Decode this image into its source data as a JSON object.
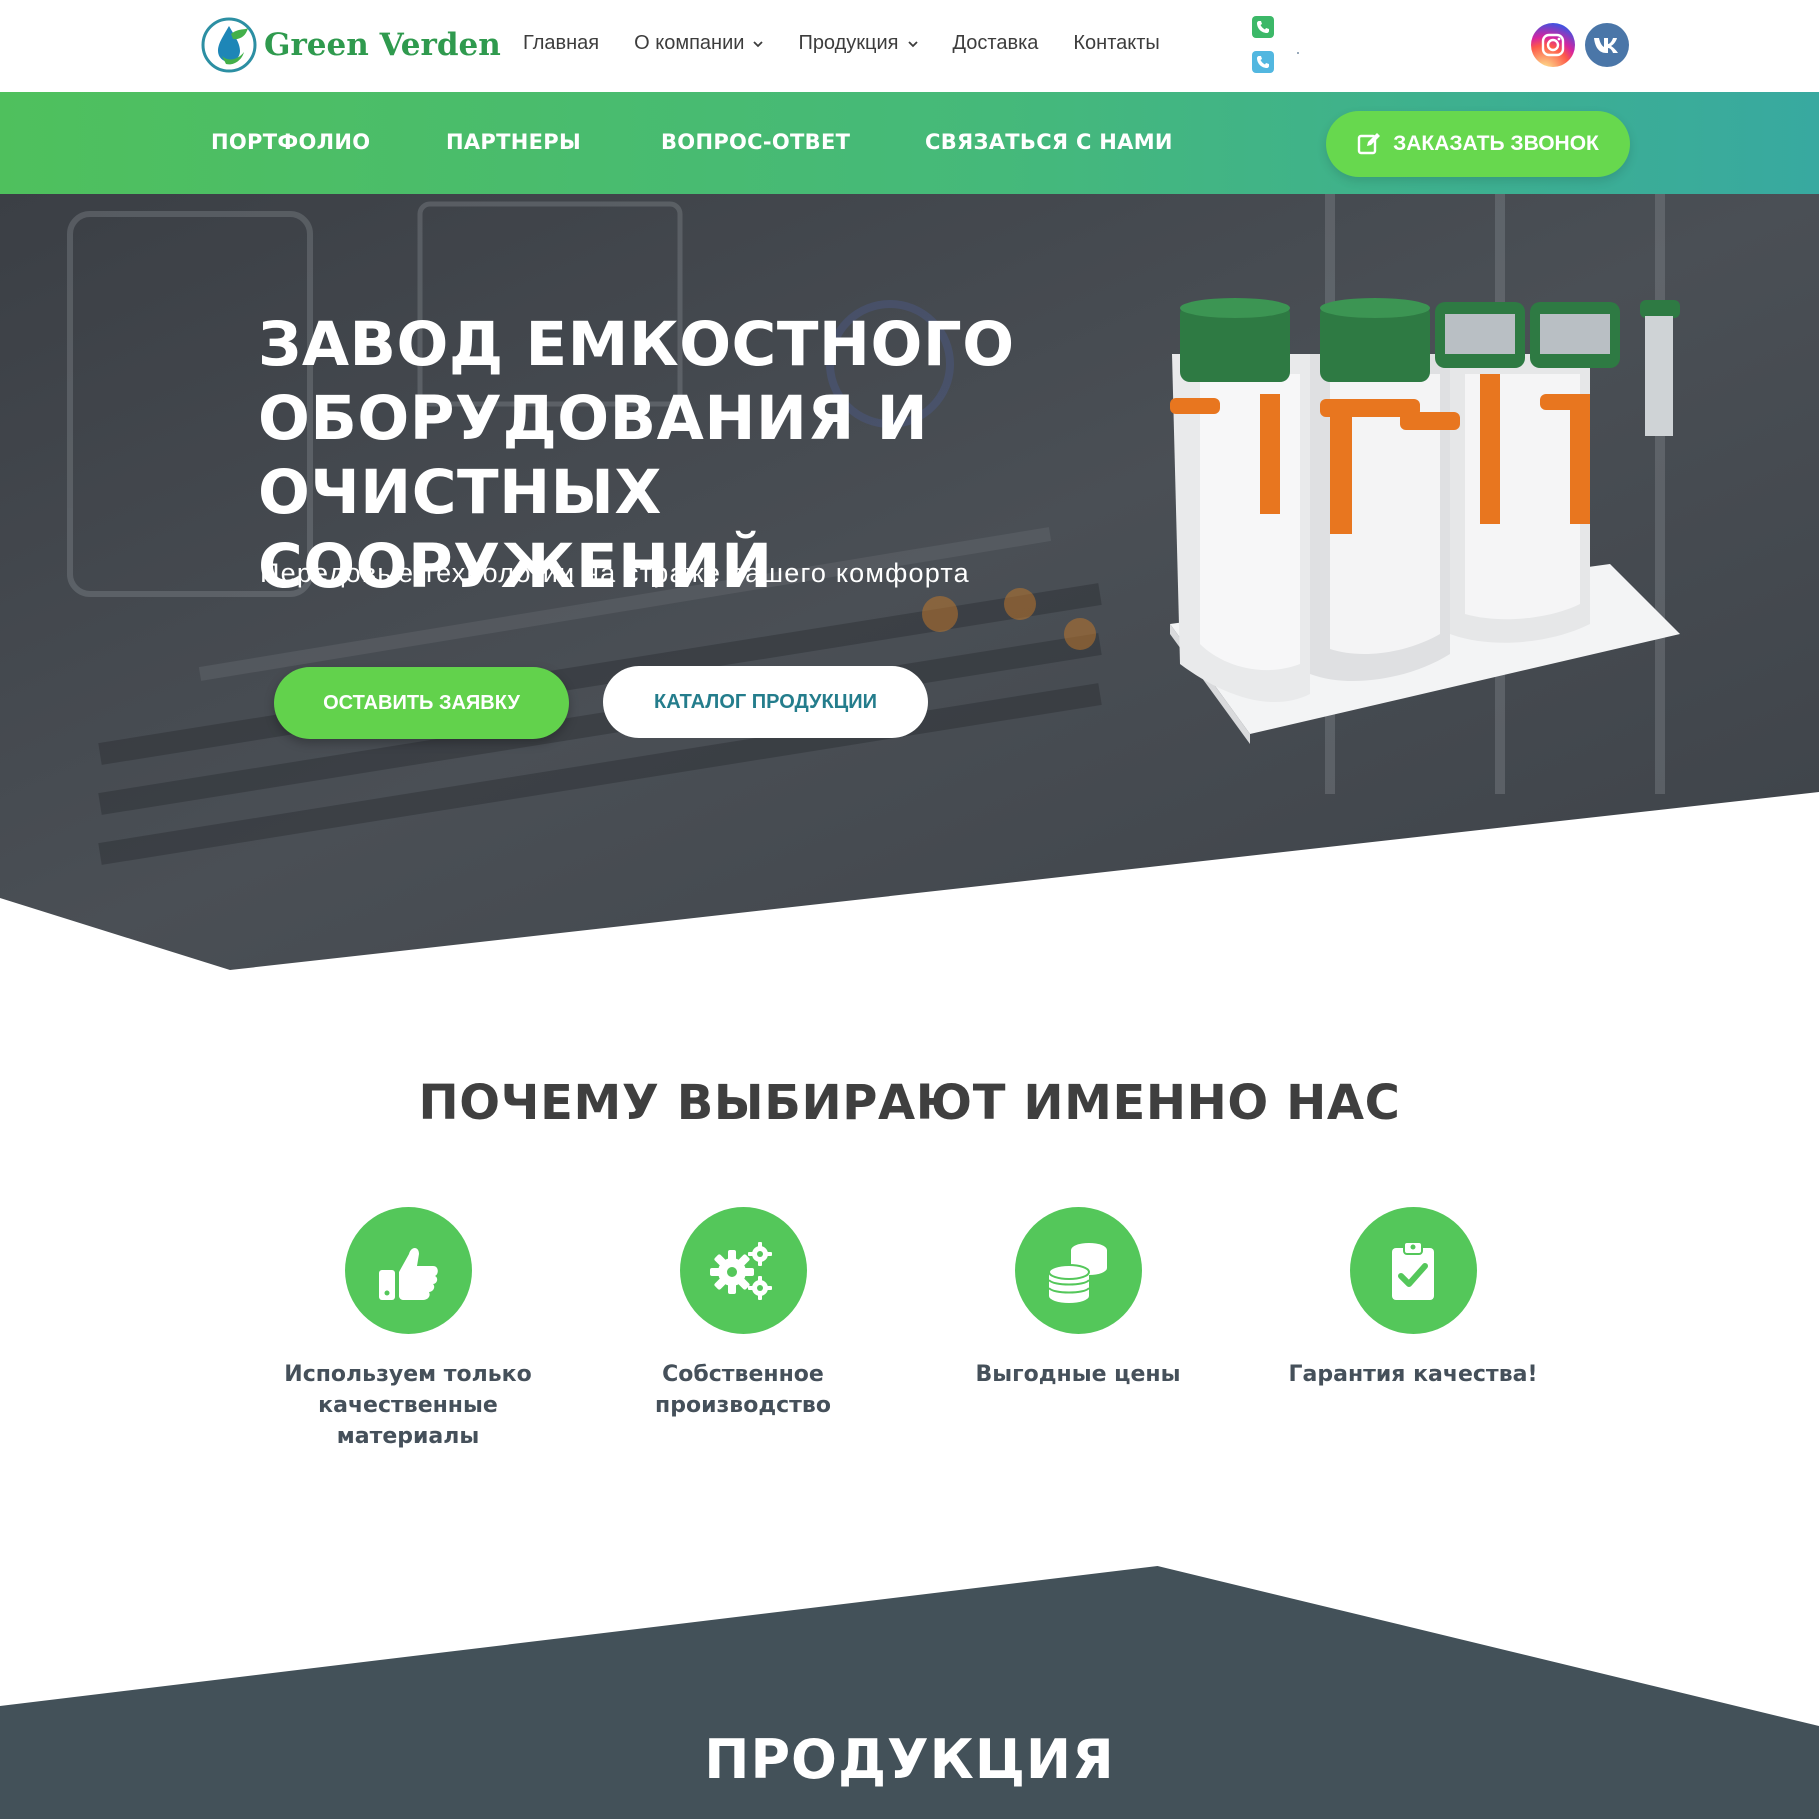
{
  "header": {
    "logo_text": "Green Verden",
    "nav": [
      {
        "label": "Главная",
        "has_dropdown": false
      },
      {
        "label": "О компании",
        "has_dropdown": true
      },
      {
        "label": "Продукция",
        "has_dropdown": true
      },
      {
        "label": "Доставка",
        "has_dropdown": false
      },
      {
        "label": "Контакты",
        "has_dropdown": false
      }
    ],
    "phone_icons": [
      "whatsapp-phone-icon",
      "telegram-phone-icon"
    ],
    "social": [
      {
        "name": "instagram-icon",
        "color": "#d6249f"
      },
      {
        "name": "vk-icon",
        "color": "#4a76a8"
      }
    ]
  },
  "subnav": {
    "items": [
      "ПОРТФОЛИО",
      "ПАРТНЕРЫ",
      "ВОПРОС-ОТВЕТ",
      "СВЯЗАТЬСЯ С НАМИ"
    ],
    "callback_label": "ЗАКАЗАТЬ ЗВОНОК",
    "callback_icon": "edit-icon"
  },
  "hero": {
    "title_lines": [
      "ЗАВОД ЕМКОСТНОГО",
      "ОБОРУДОВАНИЯ И",
      "ОЧИСТНЫХ СООРУЖЕНИЙ"
    ],
    "subtitle": "Передовые технологии на страже вашего комфорта",
    "primary_button": "ОСТАВИТЬ ЗАЯВКУ",
    "secondary_button": "КАТАЛОГ ПРОДУКЦИИ"
  },
  "why": {
    "title": "ПОЧЕМУ ВЫБИРАЮТ ИМЕННО НАС",
    "features": [
      {
        "icon": "thumbs-up-icon",
        "lines": [
          "Используем только",
          "качественные",
          "материалы"
        ]
      },
      {
        "icon": "gears-icon",
        "lines": [
          "Собственное",
          "производство"
        ]
      },
      {
        "icon": "coins-icon",
        "lines": [
          "Выгодные цены"
        ]
      },
      {
        "icon": "clipboard-check-icon",
        "lines": [
          "Гарантия качества!"
        ]
      }
    ]
  },
  "products": {
    "title": "ПРОДУКЦИЯ"
  },
  "colors": {
    "brand_green": "#54c75a",
    "button_green": "#62d24c",
    "teal": "#38a9a0",
    "heading_dark": "#3f3f3f"
  }
}
